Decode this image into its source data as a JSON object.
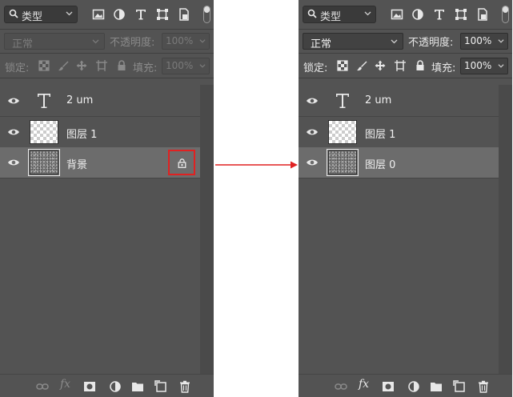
{
  "colors": {
    "panel_bg": "#535353",
    "selected_row": "#6c6c6c",
    "highlight": "#e02121",
    "arrow": "#e02121"
  },
  "left_panel": {
    "filter": {
      "label": "类型",
      "icon": "search-icon"
    },
    "filter_icons": [
      "image-filter-icon",
      "adjustment-filter-icon",
      "type-filter-icon",
      "shape-filter-icon",
      "smart-object-filter-icon"
    ],
    "blend_mode": "正常",
    "opacity_label": "不透明度:",
    "opacity_value": "100%",
    "lock_label": "锁定:",
    "fill_label": "填充:",
    "fill_value": "100%",
    "layers": [
      {
        "name": "2 um",
        "type": "text"
      },
      {
        "name": "图层 1",
        "type": "raster"
      },
      {
        "name": "背景",
        "type": "background",
        "locked": true,
        "selected": true
      }
    ],
    "bottom_icons": [
      "link-layers-icon",
      "fx-icon",
      "layer-mask-icon",
      "adjustment-layer-icon",
      "group-folder-icon",
      "new-layer-icon",
      "trash-icon"
    ],
    "fx_label": "fx"
  },
  "right_panel": {
    "filter": {
      "label": "类型",
      "icon": "search-icon"
    },
    "blend_mode": "正常",
    "opacity_label": "不透明度:",
    "opacity_value": "100%",
    "lock_label": "锁定:",
    "fill_label": "填充:",
    "fill_value": "100%",
    "layers": [
      {
        "name": "2 um",
        "type": "text"
      },
      {
        "name": "图层 1",
        "type": "raster"
      },
      {
        "name": "图层 0",
        "type": "raster",
        "selected": true
      }
    ],
    "fx_label": "fx"
  }
}
